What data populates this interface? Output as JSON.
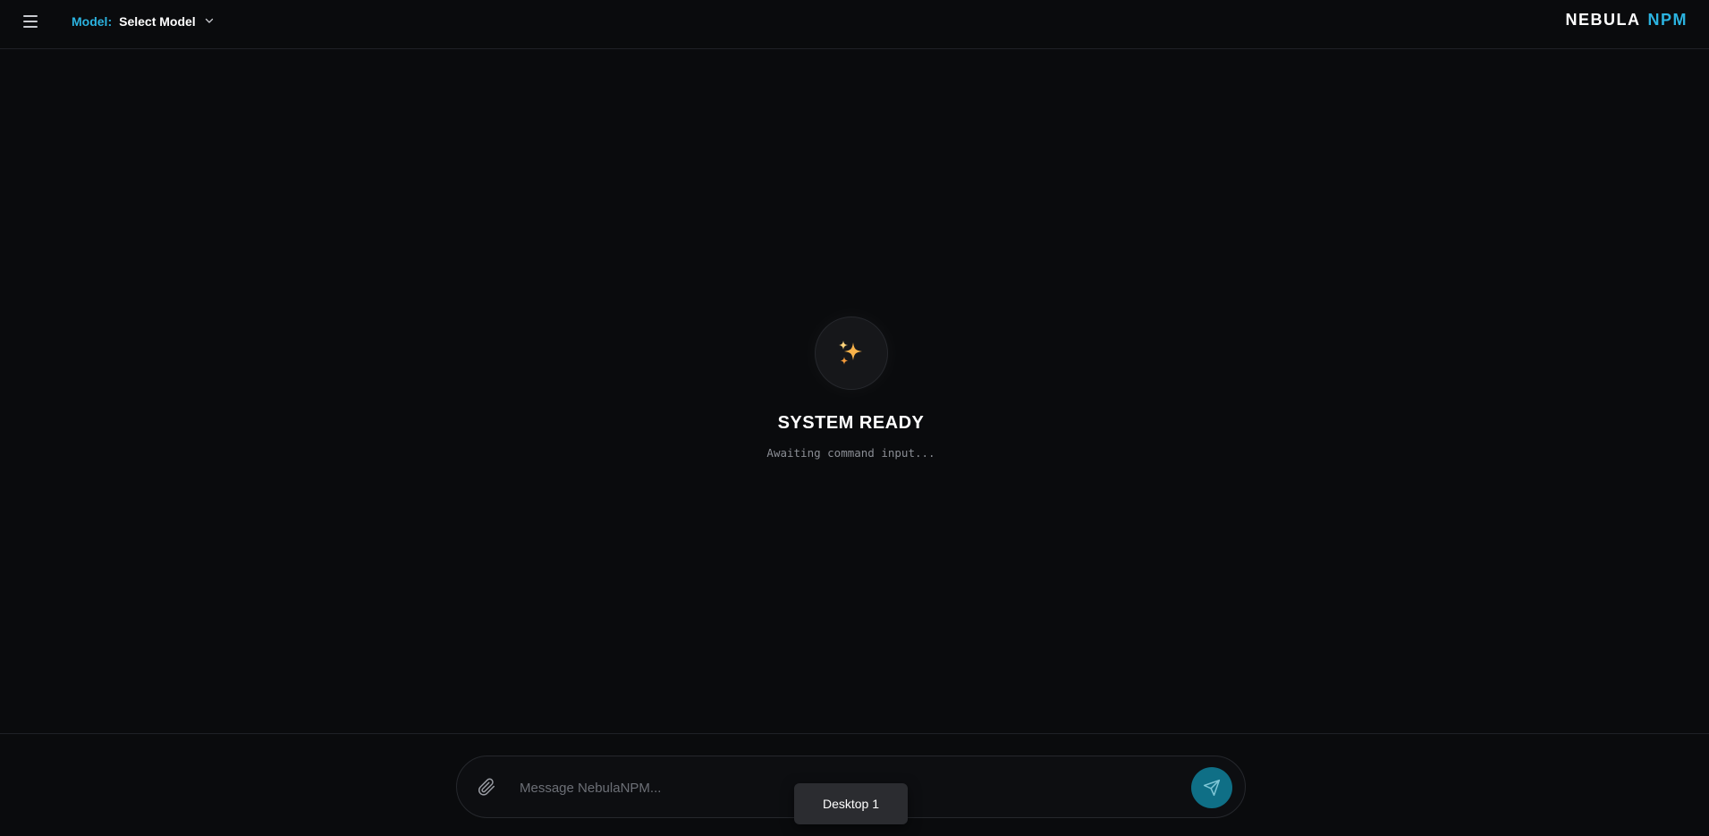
{
  "header": {
    "model_label": "Model:",
    "model_value": "Select Model",
    "brand_primary": "NEBULA",
    "brand_secondary": "NPM"
  },
  "main": {
    "status_icon": "sparkles-icon",
    "status_title": "SYSTEM READY",
    "status_subtitle": "Awaiting command input..."
  },
  "composer": {
    "placeholder": "Message NebulaNPM...",
    "value": ""
  },
  "toast": {
    "label": "Desktop 1"
  },
  "colors": {
    "background": "#0a0b0d",
    "accent": "#2bb3e0",
    "send_button": "#0f6f86",
    "toast_bg": "#2b2c30"
  },
  "icons": {
    "menu": "hamburger-menu-icon",
    "model_dropdown": "chevron-down-icon",
    "attach": "paperclip-icon",
    "send": "send-icon"
  }
}
